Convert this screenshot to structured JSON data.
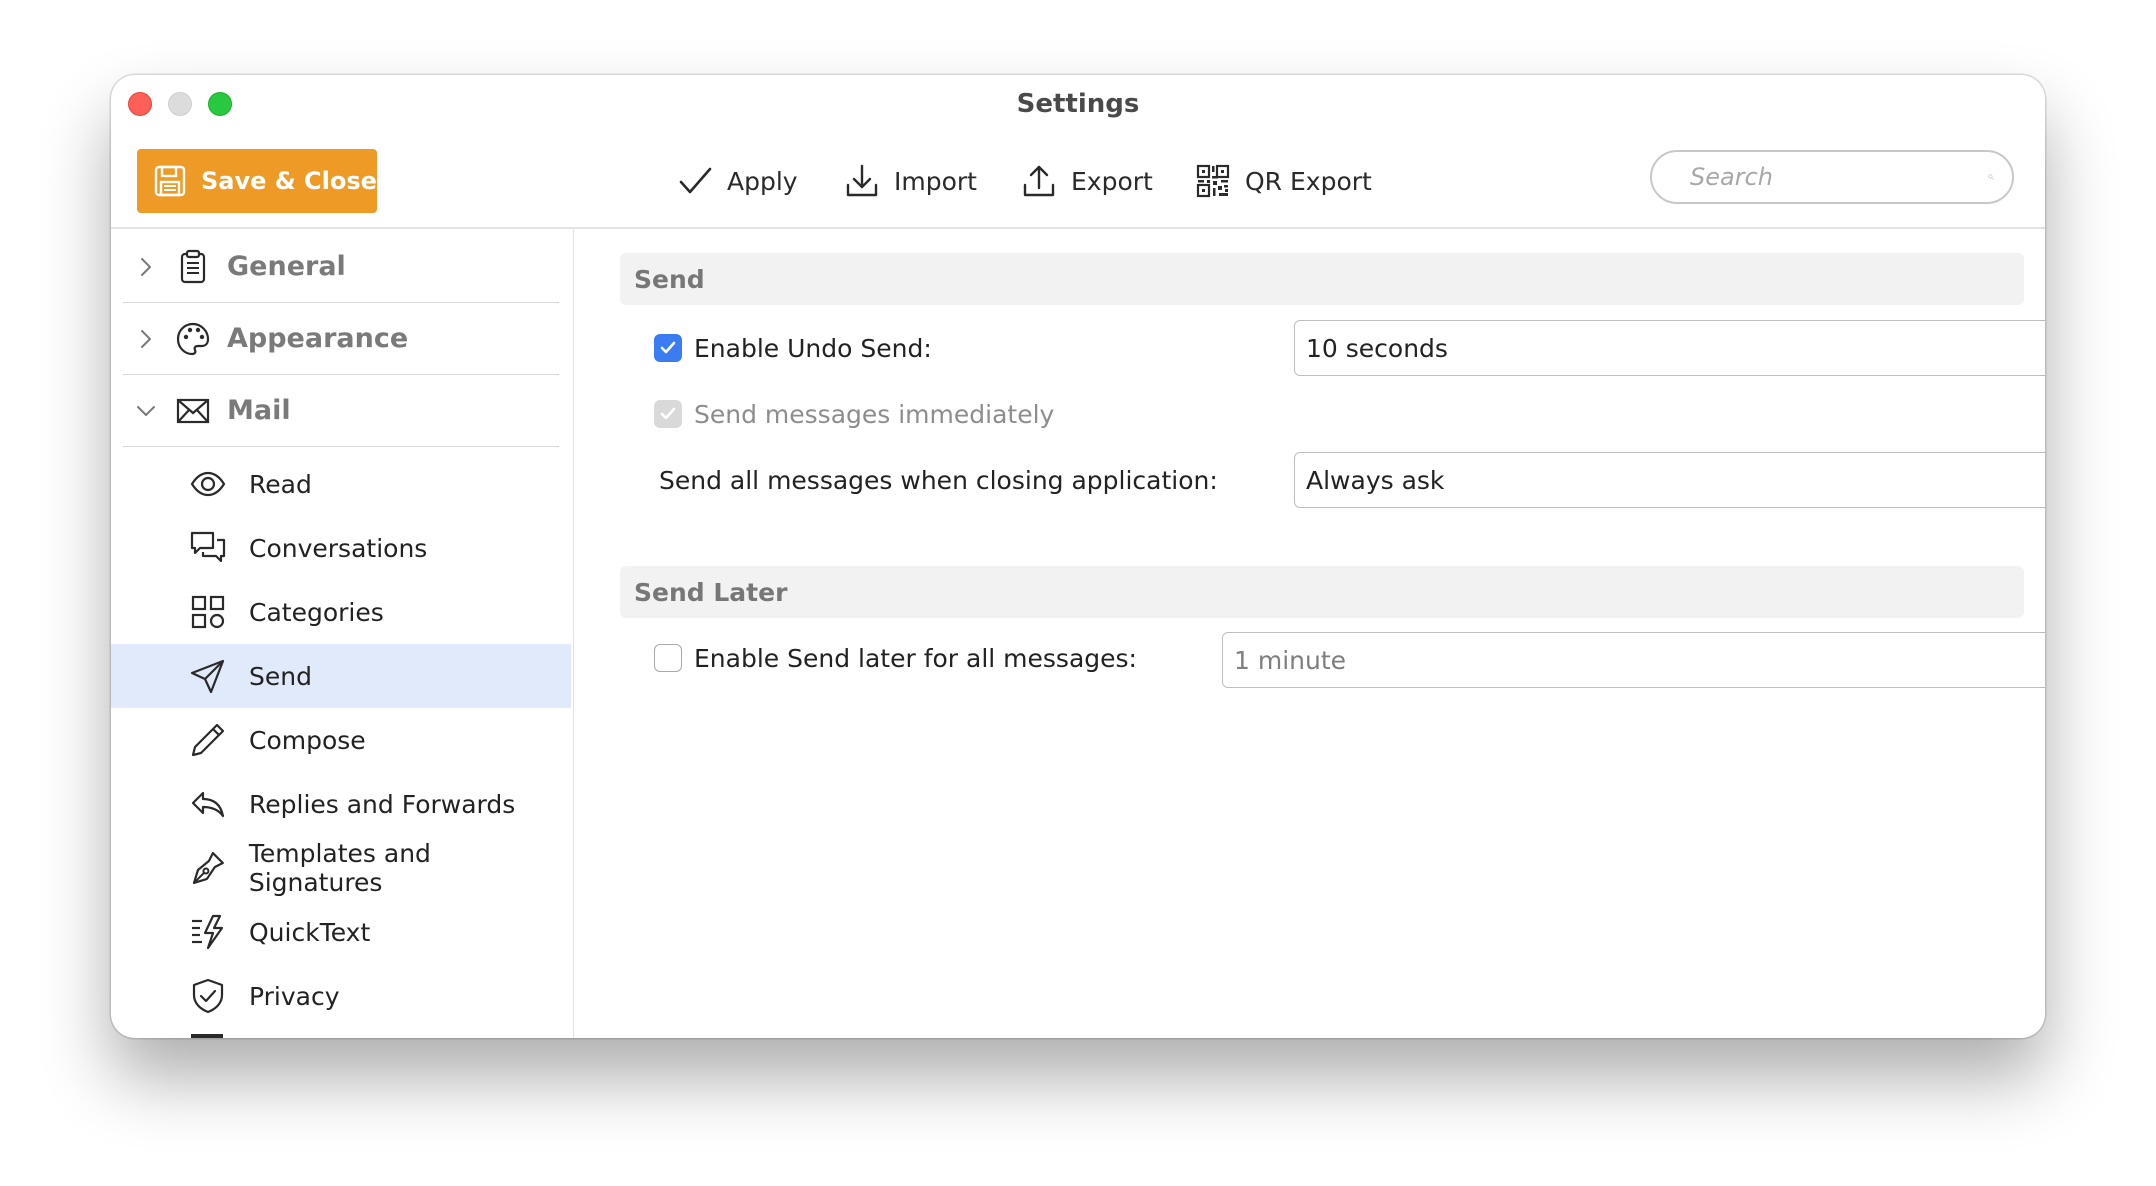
{
  "window": {
    "title": "Settings"
  },
  "toolbar": {
    "save_close": "Save & Close",
    "apply": "Apply",
    "import": "Import",
    "export": "Export",
    "qr_export": "QR Export",
    "search_placeholder": "Search"
  },
  "sidebar": {
    "categories": [
      {
        "label": "General",
        "expanded": false,
        "icon": "clipboard-icon"
      },
      {
        "label": "Appearance",
        "expanded": false,
        "icon": "palette-icon"
      },
      {
        "label": "Mail",
        "expanded": true,
        "icon": "envelope-icon"
      }
    ],
    "items": [
      {
        "label": "Read",
        "icon": "eye-icon"
      },
      {
        "label": "Conversations",
        "icon": "speech-bubbles-icon"
      },
      {
        "label": "Categories",
        "icon": "grid-icon"
      },
      {
        "label": "Send",
        "icon": "paper-plane-icon",
        "active": true
      },
      {
        "label": "Compose",
        "icon": "pencil-icon"
      },
      {
        "label": "Replies and Forwards",
        "icon": "reply-icon"
      },
      {
        "label": "Templates and Signatures",
        "icon": "pen-nib-icon"
      },
      {
        "label": "QuickText",
        "icon": "quicktext-icon"
      },
      {
        "label": "Privacy",
        "icon": "shield-icon"
      }
    ]
  },
  "content": {
    "send_section": {
      "header": "Send",
      "undo_send": {
        "label": "Enable Undo Send:",
        "checked": true,
        "value": "10 seconds"
      },
      "send_immediately": {
        "label": "Send messages immediately",
        "checked": true,
        "disabled": true
      },
      "send_on_close": {
        "label": "Send all messages when closing application:",
        "value": "Always ask"
      }
    },
    "send_later_section": {
      "header": "Send Later",
      "send_later": {
        "label": "Enable Send later for all messages:",
        "checked": false,
        "value": "1 minute"
      }
    }
  },
  "colors": {
    "accent_orange": "#ee9a26",
    "checkbox_blue": "#3b7df1",
    "active_item_bg": "#e1eafb"
  }
}
